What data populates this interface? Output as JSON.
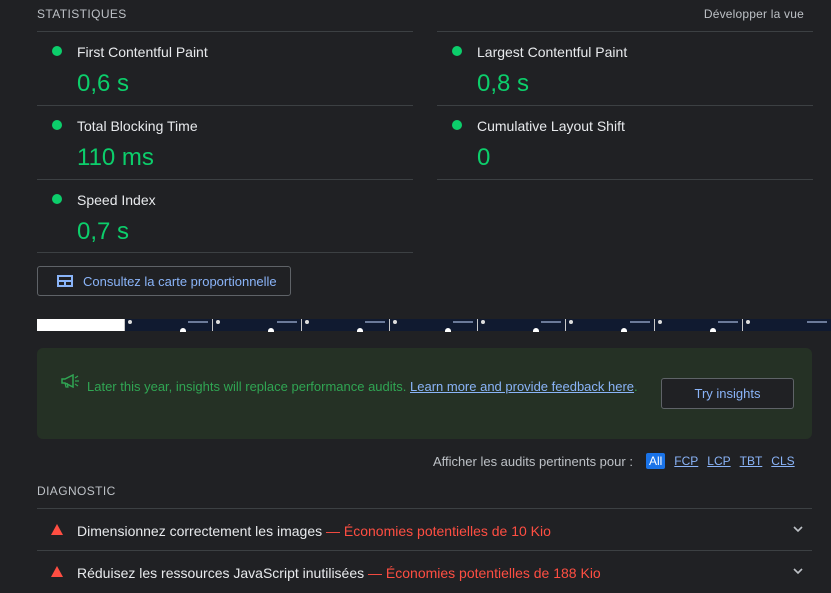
{
  "header": {
    "title": "STATISTIQUES",
    "expand_label": "Développer la vue"
  },
  "metrics": [
    {
      "label": "First Contentful Paint",
      "value": "0,6 s",
      "status": "pass"
    },
    {
      "label": "Largest Contentful Paint",
      "value": "0,8 s",
      "status": "pass"
    },
    {
      "label": "Total Blocking Time",
      "value": "110 ms",
      "status": "pass"
    },
    {
      "label": "Cumulative Layout Shift",
      "value": "0",
      "status": "pass"
    },
    {
      "label": "Speed Index",
      "value": "0,7 s",
      "status": "pass"
    }
  ],
  "treemap": {
    "label": "Consultez la carte proportionnelle",
    "icon": "treemap-icon"
  },
  "insights": {
    "message": "Later this year, insights will replace performance audits. ",
    "link": "Learn more and provide feedback here",
    "button": "Try insights",
    "icon": "megaphone-icon"
  },
  "filter": {
    "label": "Afficher les audits pertinents pour :",
    "options": [
      "All",
      "FCP",
      "LCP",
      "TBT",
      "CLS"
    ],
    "selected": "All"
  },
  "diagnostic": {
    "title": "DIAGNOSTIC",
    "audits": [
      {
        "title": "Dimensionnez correctement les images",
        "savings": " — Économies potentielles de 10 Kio"
      },
      {
        "title": "Réduisez les ressources JavaScript inutilisées",
        "savings": " — Économies potentielles de 188 Kio"
      }
    ]
  },
  "colors": {
    "pass": "#0cce6b",
    "fail": "#ff4e42",
    "link": "#8ab4f8",
    "background": "#202124"
  }
}
